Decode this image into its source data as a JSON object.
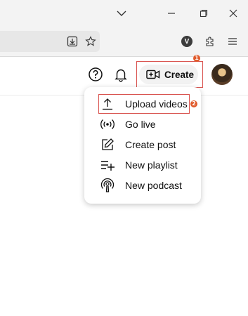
{
  "browser": {
    "window_controls": [
      "chevron-down",
      "minimize",
      "restore",
      "close"
    ],
    "toolbar_icons": [
      "download",
      "star",
      "extension-v",
      "puzzle",
      "menu"
    ],
    "extension_letter": "V"
  },
  "header": {
    "create_label": "Create",
    "annotation_1": "1",
    "annotation_2": "2"
  },
  "create_menu": {
    "items": [
      {
        "label": "Upload videos",
        "icon": "upload-icon"
      },
      {
        "label": "Go live",
        "icon": "live-icon"
      },
      {
        "label": "Create post",
        "icon": "edit-icon"
      },
      {
        "label": "New playlist",
        "icon": "playlist-add-icon"
      },
      {
        "label": "New podcast",
        "icon": "podcast-icon"
      }
    ]
  },
  "colors": {
    "annotation": "#d9534f",
    "badge": "#e05a2b",
    "chrome": "#f3f3f3"
  }
}
